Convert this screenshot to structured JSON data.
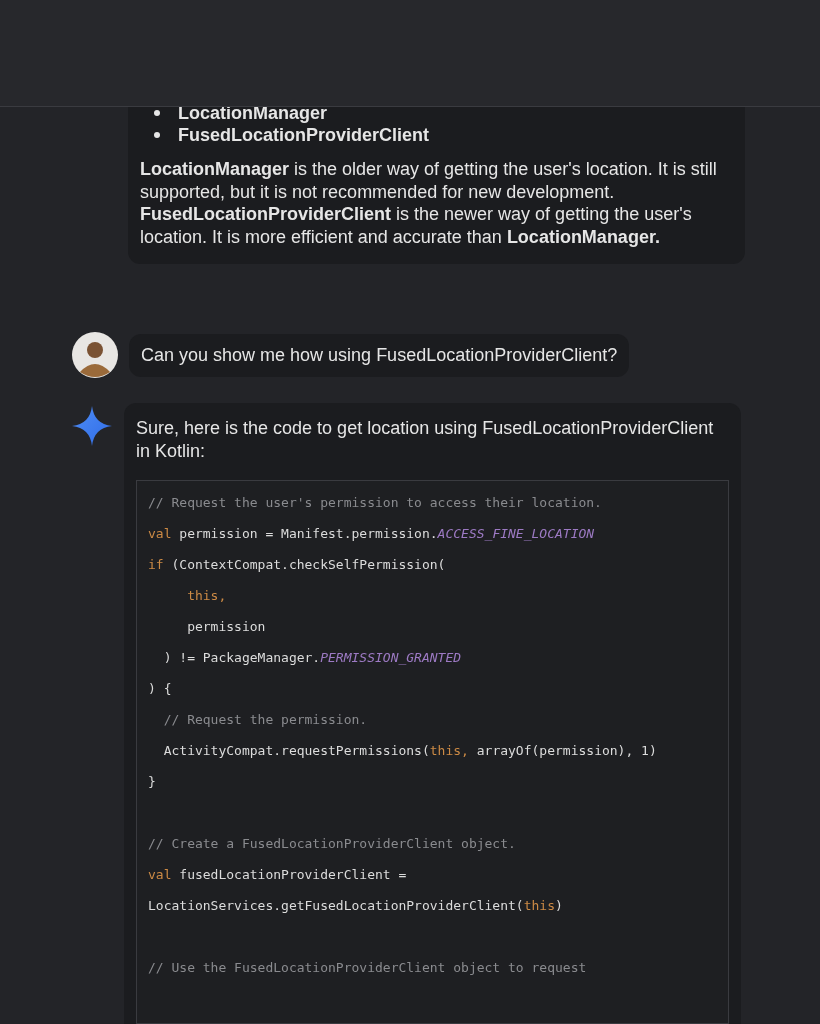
{
  "messages": [
    {
      "kind": "model",
      "bullets": [
        "LocationManager",
        "FusedLocationProviderClient"
      ],
      "paragraph": "**LocationManager** is the older way of getting the user's location. It is still supported, but it is not recommended for new development. **FusedLocationProviderClient** is the newer way of getting the user's location. It is more efficient and accurate than **LocationManager.**"
    },
    {
      "kind": "user",
      "text": "Can you show me how using FusedLocationProviderClient?"
    },
    {
      "kind": "model",
      "text": "Sure, here is the code to get location using FusedLocationProviderClient in Kotlin:",
      "code": [
        {
          "kind": "code",
          "tokens": [
            {
              "kind": "comment",
              "text": "// Request the user's permission to access their location."
            }
          ]
        },
        {
          "kind": "code",
          "tokens": [
            {
              "kind": "keyword",
              "text": "val"
            },
            {
              "kind": "plain",
              "text": " permission = Manifest.permission."
            },
            {
              "kind": "constant",
              "text": "ACCESS_FINE_LOCATION"
            }
          ]
        },
        {
          "kind": "code",
          "tokens": [
            {
              "kind": "keyword",
              "text": "if"
            },
            {
              "kind": "plain",
              "text": " (ContextCompat.checkSelfPermission("
            }
          ]
        },
        {
          "kind": "code",
          "tokens": [
            {
              "kind": "keyword",
              "text": "     this,"
            }
          ]
        },
        {
          "kind": "code",
          "tokens": [
            {
              "kind": "plain",
              "text": "     permission"
            }
          ]
        },
        {
          "kind": "code",
          "tokens": [
            {
              "kind": "plain",
              "text": "  ) != PackageManager."
            },
            {
              "kind": "constant",
              "text": "PERMISSION_GRANTED"
            }
          ]
        },
        {
          "kind": "code",
          "tokens": [
            {
              "kind": "plain",
              "text": ") {"
            }
          ]
        },
        {
          "kind": "code",
          "tokens": [
            {
              "kind": "comment",
              "text": "  // Request the permission."
            }
          ]
        },
        {
          "kind": "code",
          "tokens": [
            {
              "kind": "plain",
              "text": "  ActivityCompat.requestPermissions("
            },
            {
              "kind": "keyword",
              "text": "this,"
            },
            {
              "kind": "plain",
              "text": " arrayOf(permission), 1)"
            }
          ]
        },
        {
          "kind": "code",
          "tokens": [
            {
              "kind": "plain",
              "text": "}"
            }
          ]
        },
        {
          "kind": "blank"
        },
        {
          "kind": "code",
          "tokens": [
            {
              "kind": "comment",
              "text": "// Create a FusedLocationProviderClient object."
            }
          ]
        },
        {
          "kind": "code",
          "tokens": [
            {
              "kind": "keyword",
              "text": "val"
            },
            {
              "kind": "plain",
              "text": " fusedLocationProviderClient ="
            }
          ]
        },
        {
          "kind": "code",
          "tokens": [
            {
              "kind": "plain",
              "text": "LocationServices.getFusedLocationProviderClient("
            },
            {
              "kind": "keyword",
              "text": "this"
            },
            {
              "kind": "plain",
              "text": ")"
            }
          ]
        },
        {
          "kind": "blank"
        },
        {
          "kind": "code",
          "tokens": [
            {
              "kind": "comment",
              "text": "// Use the FusedLocationProviderClient object to request"
            }
          ]
        }
      ]
    }
  ]
}
